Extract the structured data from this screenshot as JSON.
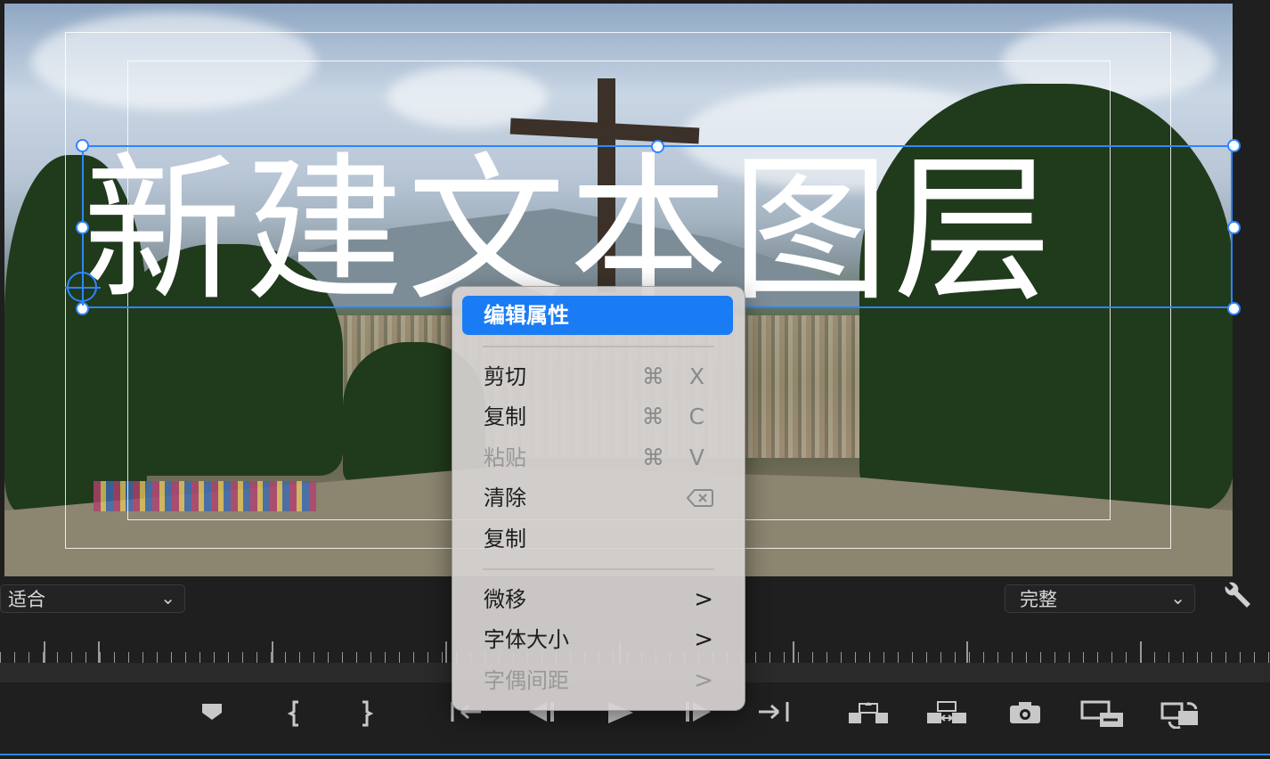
{
  "viewer": {
    "title_text": "新建文本图层"
  },
  "controls_bar": {
    "fit_value": "适合",
    "quality_value": "完整",
    "wrench_icon": "wrench-icon"
  },
  "context_menu": {
    "items": [
      {
        "label": "编辑属性",
        "active": true
      },
      {
        "label": "剪切",
        "shortcut": "⌘ X"
      },
      {
        "label": "复制",
        "shortcut": "⌘ C"
      },
      {
        "label": "粘贴",
        "shortcut": "⌘ V",
        "disabled": true
      },
      {
        "label": "清除",
        "shortcut_icon": "delete-key-icon"
      },
      {
        "label": "复制"
      },
      {
        "label": "微移",
        "submenu": true
      },
      {
        "label": "字体大小",
        "submenu": true
      },
      {
        "label": "字偶间距",
        "submenu": true,
        "disabled": true
      }
    ],
    "submenu_arrow": ">"
  },
  "transport": {
    "icons": [
      "add-marker-icon",
      "mark-in-icon",
      "mark-out-icon",
      "go-to-in-icon",
      "step-back-icon",
      "play-icon",
      "step-forward-icon",
      "go-to-out-icon",
      "lift-icon",
      "extract-icon",
      "export-frame-icon",
      "insert-icon",
      "overwrite-icon"
    ]
  },
  "colors": {
    "accent": "#1a7cf5",
    "selection": "#2d86ff",
    "panel_bg": "#1f1f1f"
  }
}
